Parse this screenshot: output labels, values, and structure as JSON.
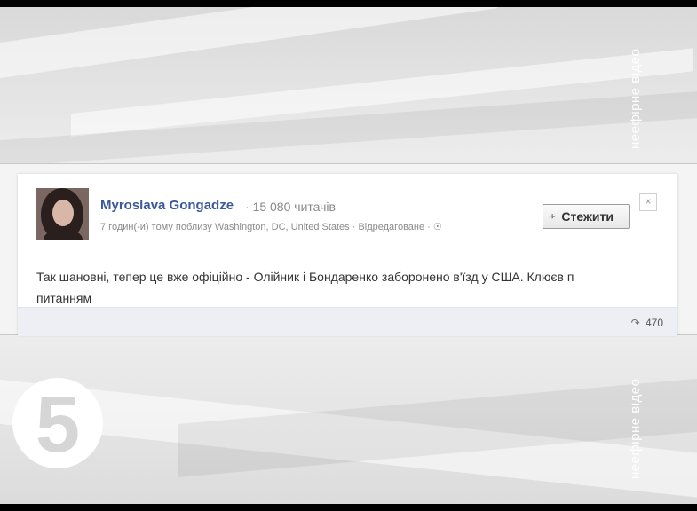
{
  "watermark": {
    "top_text": "неефірне відео",
    "bottom_text": "неефірне відео"
  },
  "post": {
    "author": "Myroslava Gongadze",
    "separator": "·",
    "readers": "15 080 читачів",
    "meta": "7 годин(-и) тому поблизу Washington, DC, United States · Відредаговане · ",
    "follow_label": "Стежити",
    "close_label": "×",
    "text_line1": "Так шановні, тепер це вже офіційно - Олійник і Бондаренко заборонено в'їзд у США. Клюєв п",
    "text_line2": "питанням",
    "shares": "470"
  },
  "logo": {
    "label": "5"
  },
  "icons": {
    "rss": "rss-icon",
    "share": "share-icon",
    "globe": "globe-icon"
  }
}
